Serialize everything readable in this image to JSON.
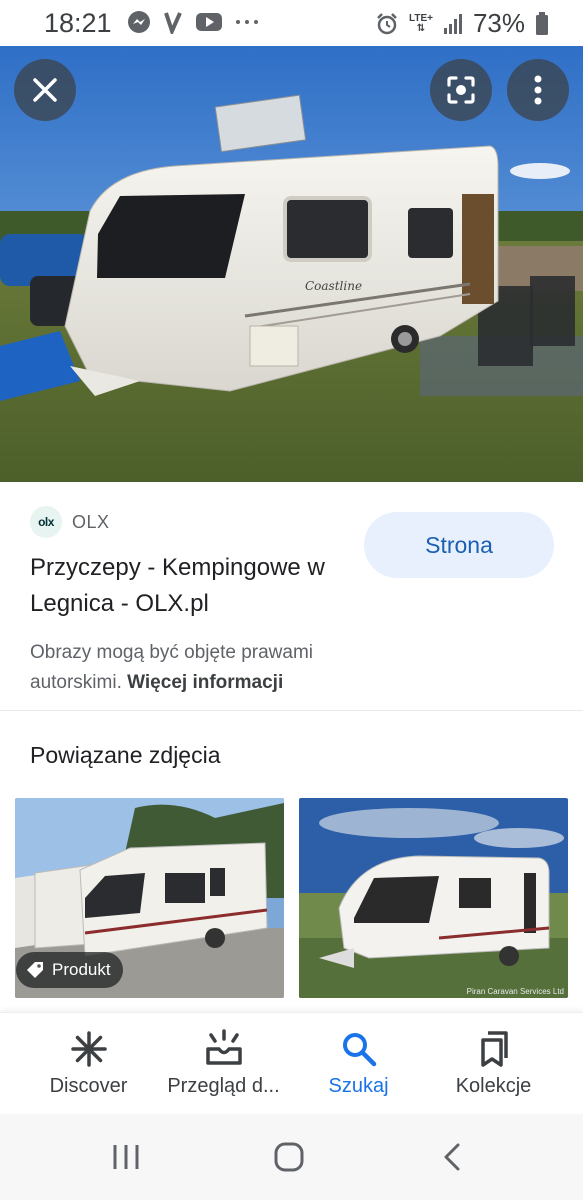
{
  "status_bar": {
    "time": "18:21",
    "left_icons": [
      "messenger-icon",
      "vinted-icon",
      "youtube-icon",
      "more-dots-icon"
    ],
    "network": "LTE+",
    "battery": "73%"
  },
  "hero": {
    "image": "white Coastline caravan parked on grass",
    "caravan_text": "Coastline",
    "buttons": {
      "close": "close-icon",
      "lens": "lens-icon",
      "more": "more-vert-icon"
    }
  },
  "result": {
    "logo_text": "olx",
    "source": "OLX",
    "title": "Przyczepy - Kempingowe w Legnica - OLX.pl",
    "visit_button": "Strona",
    "copyright_text": "Obrazy mogą być objęte prawami autorskimi.",
    "copyright_link": "Więcej informacji"
  },
  "related": {
    "title": "Powiązane zdjęcia",
    "items": [
      {
        "chip": "Produkt",
        "watermark": ""
      },
      {
        "chip": "",
        "watermark": "Piran Caravan Services Ltd"
      }
    ]
  },
  "bottom_nav": {
    "items": [
      {
        "label": "Discover",
        "icon": "asterisk-icon",
        "active": false
      },
      {
        "label": "Przegląd d...",
        "icon": "updates-icon",
        "active": false
      },
      {
        "label": "Szukaj",
        "icon": "search-icon",
        "active": true
      },
      {
        "label": "Kolekcje",
        "icon": "bookmarks-icon",
        "active": false
      }
    ]
  },
  "colors": {
    "accent": "#1a73e8",
    "button_bg": "#e8f0fe",
    "text_primary": "#202124",
    "text_secondary": "#5f6368"
  }
}
